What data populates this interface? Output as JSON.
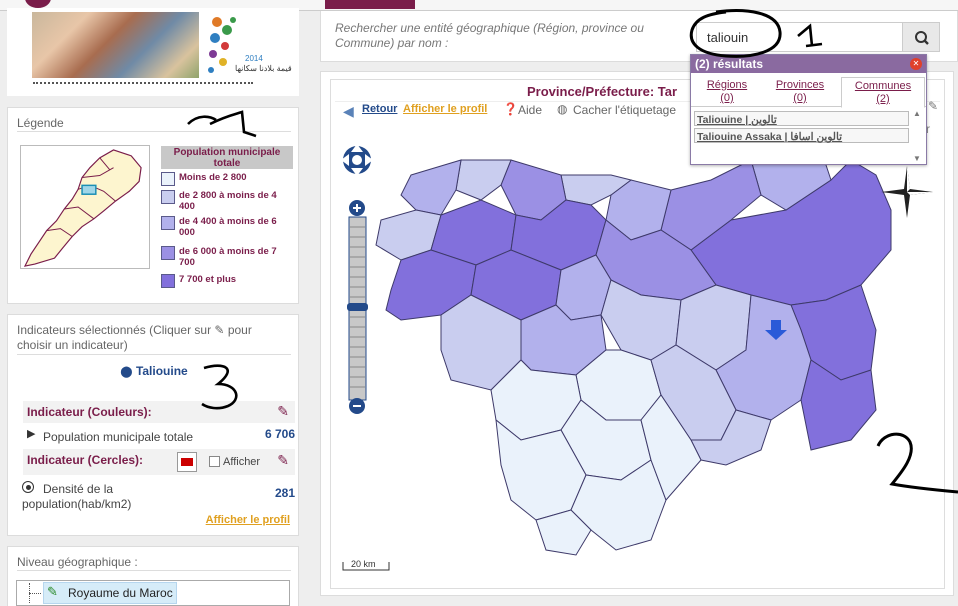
{
  "legend": {
    "title": "Légende",
    "table_header": "Population municipale totale",
    "items": [
      {
        "label": "Moins de 2 800",
        "color": "#eaf2fb"
      },
      {
        "label": "de 2 800 à moins de 4 400",
        "color": "#c9cdef"
      },
      {
        "label": "de 4 400 à moins de 6 000",
        "color": "#b2b1ec"
      },
      {
        "label": "de 6 000 à moins de 7 700",
        "color": "#9b90e4"
      },
      {
        "label": "7 700 et plus",
        "color": "#8270dc"
      }
    ]
  },
  "indicators": {
    "title": "Indicateurs sélectionnés (Cliquer sur ✎ pour choisir un indicateur)",
    "place": "Taliouine",
    "color_indicator": {
      "heading": "Indicateur (Couleurs):",
      "name": "Population municipale totale",
      "value": "6 706"
    },
    "circle_indicator": {
      "heading": "Indicateur (Cercles):",
      "show_label": "Afficher",
      "name": "Densité de la population(hab/km2)",
      "value": "281"
    },
    "profile_link": "Afficher le profil"
  },
  "geo_level": {
    "title": "Niveau géographique :",
    "tree_item": "Royaume du Maroc"
  },
  "search": {
    "hint": "Rechercher une entité géographique (Région, province ou Commune) par nom :",
    "value": "taliouin"
  },
  "results": {
    "header": "(2) résultats",
    "tabs": [
      {
        "label": "Régions",
        "count": "(0)"
      },
      {
        "label": "Provinces",
        "count": "(0)"
      },
      {
        "label": "Communes",
        "count": "(2)"
      }
    ],
    "items": [
      {
        "label": "Taliouine | تالوين"
      },
      {
        "label": "Taliouine Assaka | تالوين اسافا"
      }
    ]
  },
  "map": {
    "title": "Province/Préfecture: Tar",
    "toolbar": {
      "back": "Retour",
      "profile": "Afficher le profil",
      "help": "Aide",
      "labels": "Cacher l'étiquetage"
    },
    "scale": "20 km",
    "colors": {
      "c1": "#eaf2fb",
      "c2": "#c9cdef",
      "c3": "#b2b1ec",
      "c4": "#9b90e4",
      "c5": "#8270dc"
    }
  },
  "banner": {
    "year": "2014",
    "arabic_text": "قيمة بلادنا سكانها"
  }
}
